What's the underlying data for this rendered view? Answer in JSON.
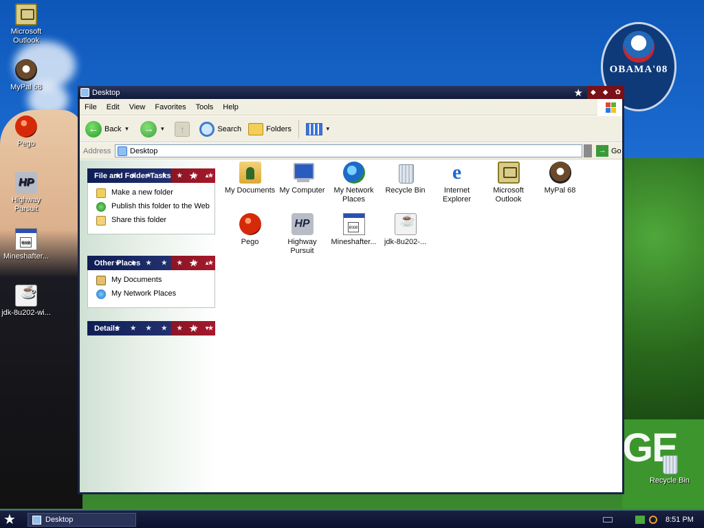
{
  "desktop": {
    "icons": [
      {
        "label": "Microsoft Outlook",
        "icon": "outlook-icon"
      },
      {
        "label": "MyPal 68",
        "icon": "mypal-icon"
      },
      {
        "label": "Pego",
        "icon": "pego-icon"
      },
      {
        "label": "Highway Pursuit",
        "icon": "highway-pursuit-icon"
      },
      {
        "label": "Mineshafter...",
        "icon": "executable-icon"
      },
      {
        "label": "jdk-8u202-wi...",
        "icon": "java-installer-icon"
      },
      {
        "label": "Recycle Bin",
        "icon": "recycle-bin-icon"
      }
    ],
    "badge_text": "OBAMA'08",
    "wallpaper_text": "GE"
  },
  "window": {
    "title": "Desktop",
    "menu": [
      "File",
      "Edit",
      "View",
      "Favorites",
      "Tools",
      "Help"
    ],
    "toolbar": {
      "back": "Back",
      "search": "Search",
      "folders": "Folders"
    },
    "address": {
      "label": "Address",
      "value": "Desktop",
      "go": "Go"
    },
    "panels": [
      {
        "title": "File and Folder Tasks",
        "items": [
          "Make a new folder",
          "Publish this folder to the Web",
          "Share this folder"
        ]
      },
      {
        "title": "Other Places",
        "items": [
          "My Documents",
          "My Network Places"
        ]
      },
      {
        "title": "Details",
        "items": []
      }
    ],
    "files": [
      {
        "label": "My Documents",
        "icon": "my-documents-icon"
      },
      {
        "label": "My Computer",
        "icon": "my-computer-icon"
      },
      {
        "label": "My Network Places",
        "icon": "network-places-icon"
      },
      {
        "label": "Recycle Bin",
        "icon": "recycle-bin-icon"
      },
      {
        "label": "Internet Explorer",
        "icon": "internet-explorer-icon"
      },
      {
        "label": "Microsoft Outlook",
        "icon": "outlook-icon"
      },
      {
        "label": "MyPal 68",
        "icon": "mypal-icon"
      },
      {
        "label": "Pego",
        "icon": "pego-icon"
      },
      {
        "label": "Highway Pursuit",
        "icon": "highway-pursuit-icon"
      },
      {
        "label": "Mineshafter...",
        "icon": "executable-icon"
      },
      {
        "label": "jdk-8u202-...",
        "icon": "java-installer-icon"
      }
    ]
  },
  "taskbar": {
    "task": "Desktop",
    "clock": "8:51 PM"
  },
  "colors": {
    "titlebar": "#101a3a",
    "panel_blue": "#22316e",
    "panel_red": "#a5182a",
    "taskbar": "#0b1230"
  }
}
